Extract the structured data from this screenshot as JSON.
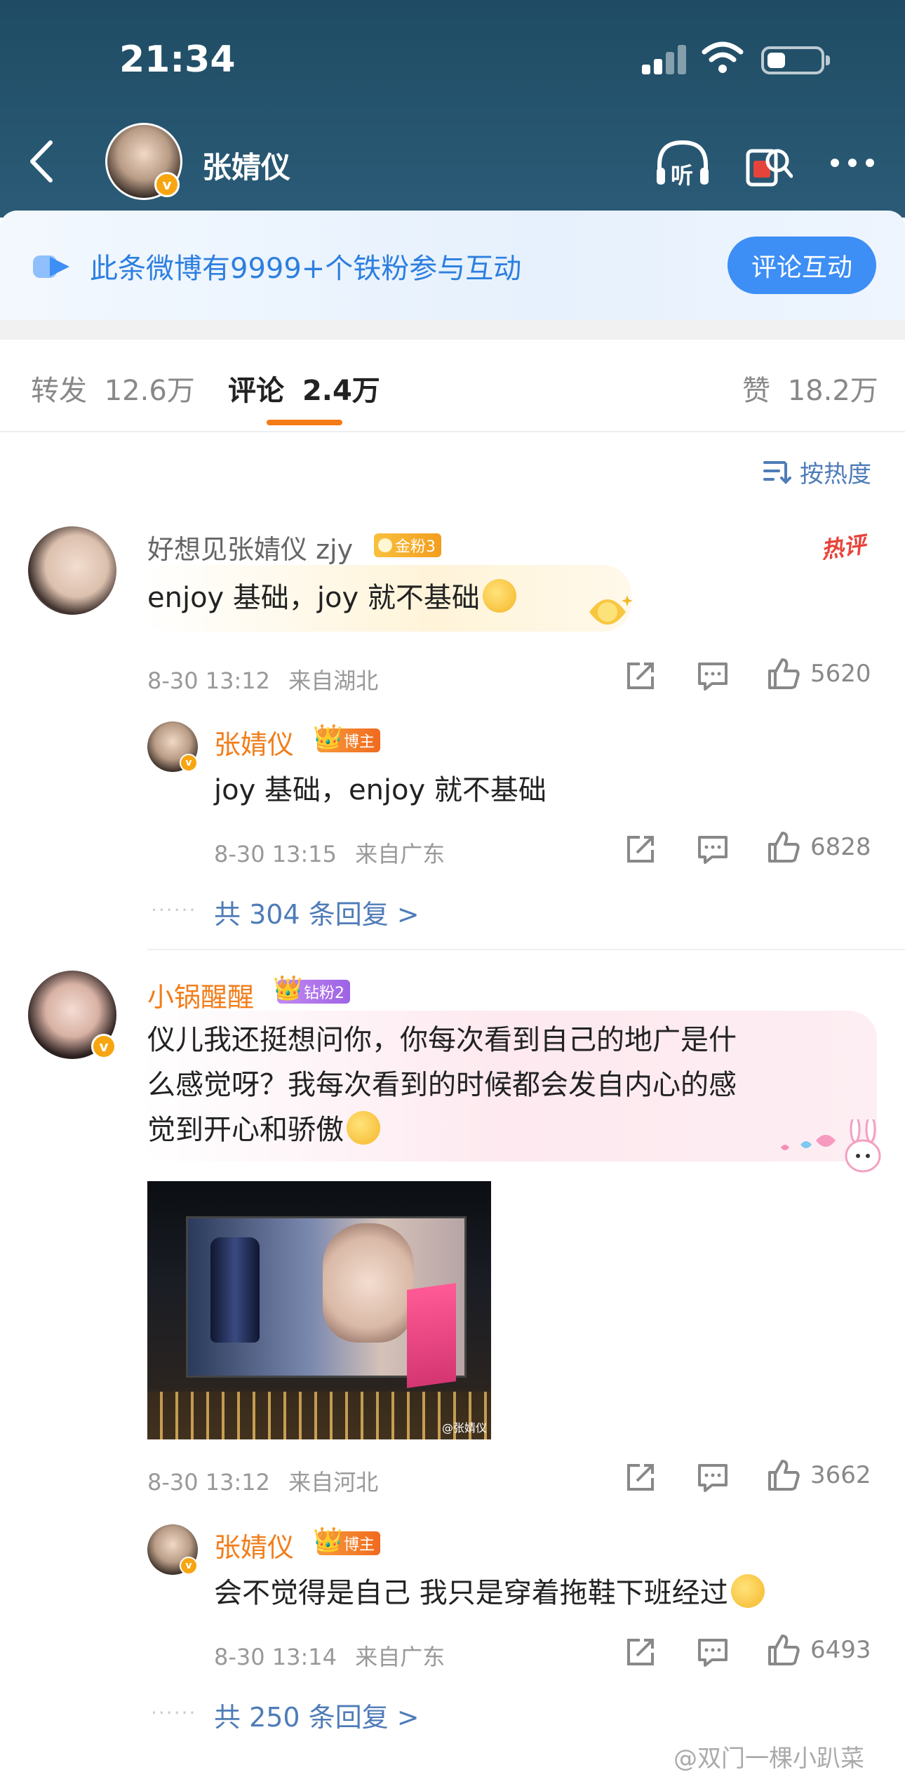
{
  "status_bar": {
    "time": "21:34",
    "battery_level": 0.35
  },
  "header": {
    "user_name": "张婧仪",
    "listen_label": "听",
    "verified_mark": "v"
  },
  "fan_banner": {
    "text": "此条微博有9999+个铁粉参与互动",
    "button": "评论互动"
  },
  "tabs": [
    {
      "label": "转发",
      "count": "12.6万"
    },
    {
      "label": "评论",
      "count": "2.4万"
    },
    {
      "label": "赞",
      "count": "18.2万"
    }
  ],
  "sort_label": "按热度",
  "comments": [
    {
      "user": "好想见张婧仪 zjy",
      "badge": "金粉3",
      "hot_tag": "热评",
      "text": "enjoy 基础，joy 就不基础",
      "time": "8-30 13:12",
      "location": "来自湖北",
      "likes": "5620",
      "reply": {
        "user": "张婧仪",
        "badge": "博主",
        "text": "joy 基础，enjoy 就不基础",
        "time": "8-30 13:15",
        "location": "来自广东",
        "likes": "6828"
      },
      "more_replies": "共 304 条回复 >"
    },
    {
      "user": "小锅醒醒",
      "badge": "钻粉2",
      "text_lines": [
        "仪儿我还挺想问你，你每次看到自己的地广是什",
        "么感觉呀？我每次看到的时候都会发自内心的感",
        "觉到开心和骄傲"
      ],
      "photo_watermark": "@张婧仪",
      "time": "8-30 13:12",
      "location": "来自河北",
      "likes": "3662",
      "reply": {
        "user": "张婧仪",
        "badge": "博主",
        "text": "会不觉得是自己 我只是穿着拖鞋下班经过",
        "time": "8-30 13:14",
        "location": "来自广东",
        "likes": "6493"
      },
      "more_replies": "共 250 条回复 >"
    }
  ],
  "dots": "······",
  "watermark": "@双门一棵小趴菜",
  "colors": {
    "header_bg": "#2b5b77",
    "accent_orange": "#f57b15",
    "link_blue": "#4f7cb8",
    "button_blue": "#3d8ef5"
  }
}
